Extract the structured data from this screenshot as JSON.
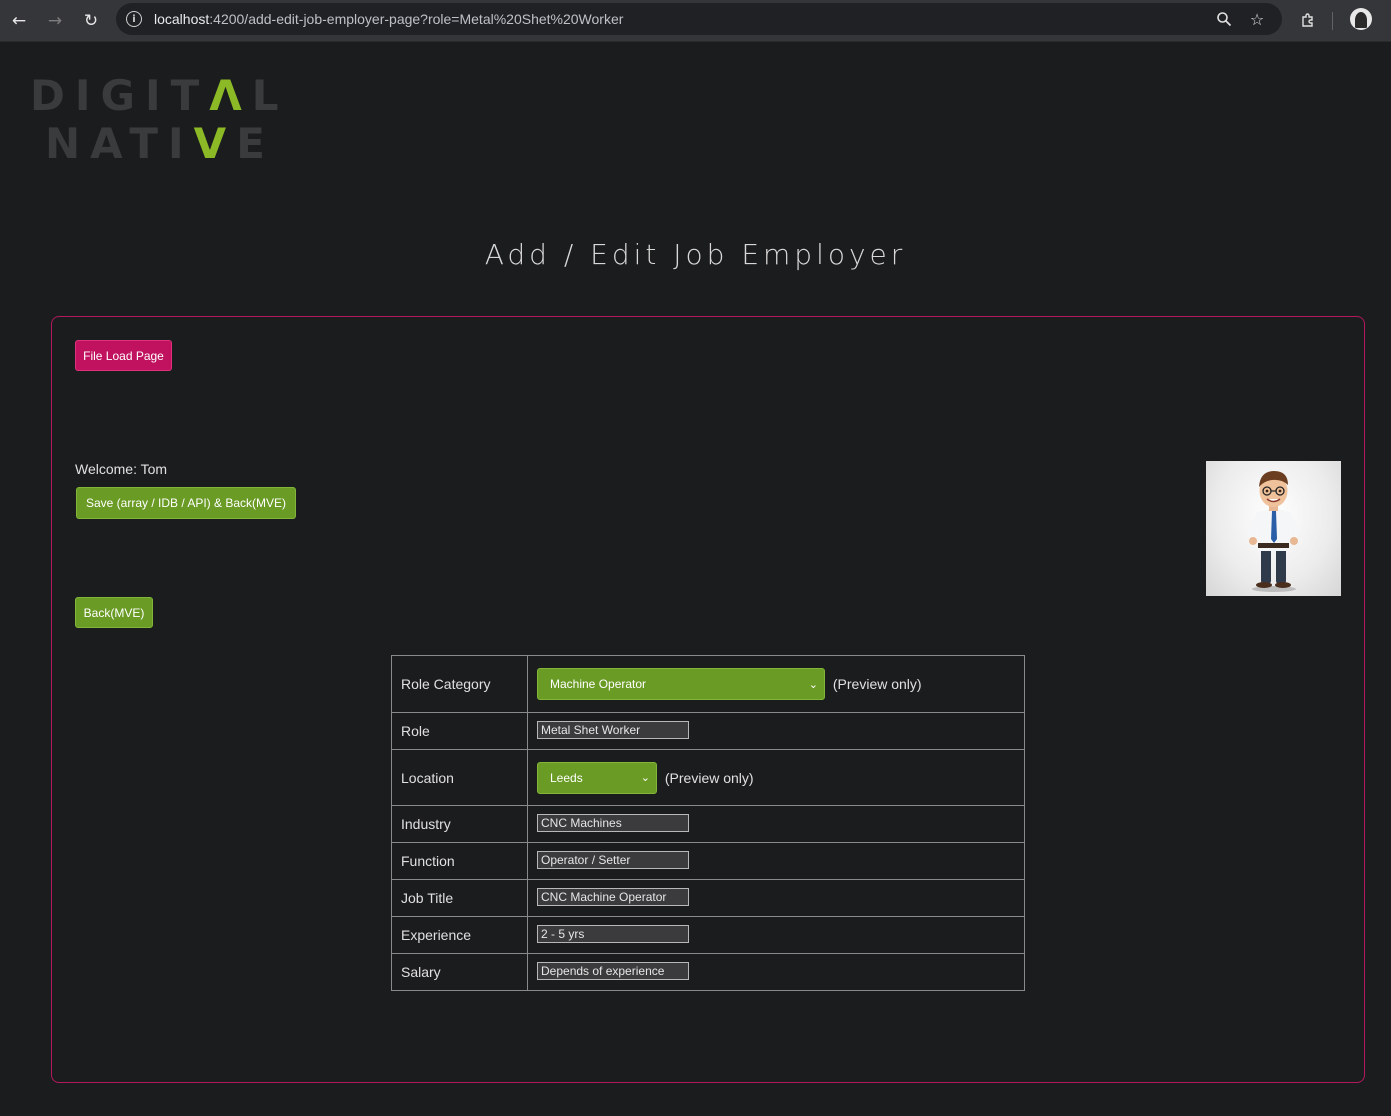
{
  "browser": {
    "url_host": "localhost",
    "url_path": ":4200/add-edit-job-employer-page?role=Metal%20Shet%20Worker"
  },
  "logo": {
    "line1": "DIGITAL",
    "line2": "NATIVE",
    "accent_color": "#8cba27"
  },
  "page": {
    "title": "Add / Edit Job Employer"
  },
  "actions": {
    "file_load_label": "File Load Page",
    "save_label": "Save (array / IDB / API) & Back(MVE)",
    "back_label": "Back(MVE)"
  },
  "welcome": "Welcome: Tom",
  "form": {
    "rows": [
      {
        "label": "Role Category",
        "type": "select",
        "value": "Machine Operator",
        "note": "(Preview only)"
      },
      {
        "label": "Role",
        "type": "text",
        "value": "Metal Shet Worker"
      },
      {
        "label": "Location",
        "type": "select",
        "value": "Leeds",
        "note": "(Preview only)"
      },
      {
        "label": "Industry",
        "type": "text",
        "value": "CNC Machines"
      },
      {
        "label": "Function",
        "type": "text",
        "value": "Operator / Setter"
      },
      {
        "label": "Job Title",
        "type": "text",
        "value": "CNC Machine Operator"
      },
      {
        "label": "Experience",
        "type": "text",
        "value": "2 - 5 yrs"
      },
      {
        "label": "Salary",
        "type": "text",
        "value": "Depends of experience"
      }
    ]
  },
  "colors": {
    "card_border": "#b3185c",
    "magenta_button": "#c0125e",
    "green_button": "#6a9b25",
    "background": "#1b1c1e"
  }
}
